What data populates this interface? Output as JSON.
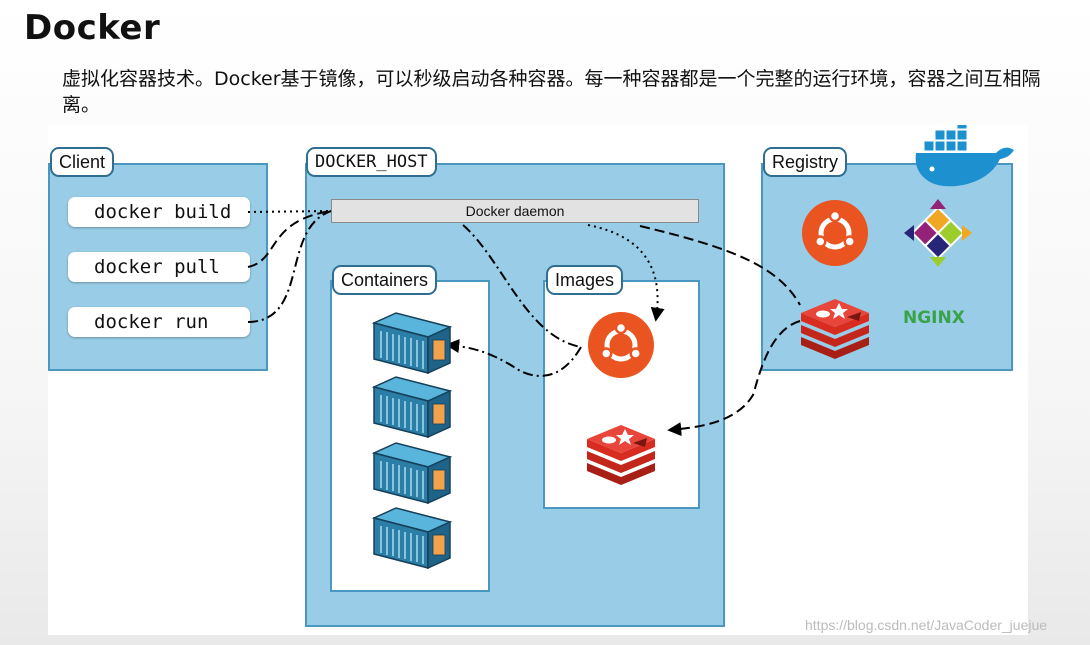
{
  "slide": {
    "title": "Docker",
    "description": "虚拟化容器技术。Docker基于镜像，可以秒级启动各种容器。每一种容器都是一个完整的运行环境，容器之间互相隔离。"
  },
  "diagram": {
    "client": {
      "title": "Client",
      "commands": [
        "docker build",
        "docker pull",
        "docker run"
      ]
    },
    "docker_host": {
      "title": "DOCKER_HOST",
      "daemon_label": "Docker daemon",
      "containers_title": "Containers",
      "images_title": "Images"
    },
    "registry": {
      "title": "Registry",
      "nginx_label": "NGINX"
    },
    "icons": [
      "docker-whale-icon",
      "ubuntu-icon",
      "centos-icon",
      "redis-icon",
      "nginx-logo",
      "container-icon"
    ],
    "colors": {
      "panel_fill": "#99cce6",
      "panel_border": "#4a97c2",
      "ubuntu": "#e95420",
      "redis": "#d82c20",
      "container": "#2b7ea6",
      "docker_blue": "#1d91cf",
      "nginx": "#3aa34a"
    }
  },
  "watermark": "https://blog.csdn.net/JavaCoder_juejue"
}
